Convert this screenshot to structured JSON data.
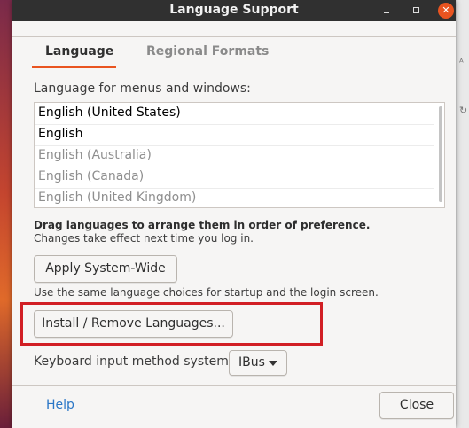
{
  "window": {
    "title": "Language Support"
  },
  "tabs": [
    {
      "label": "Language",
      "active": true
    },
    {
      "label": "Regional Formats",
      "active": false
    }
  ],
  "language_section": {
    "label": "Language for menus and windows:",
    "languages": [
      {
        "name": "English (United States)",
        "enabled": true
      },
      {
        "name": "English",
        "enabled": true
      },
      {
        "name": "English (Australia)",
        "enabled": false
      },
      {
        "name": "English (Canada)",
        "enabled": false
      },
      {
        "name": "English (United Kingdom)",
        "enabled": false
      }
    ],
    "drag_hint": "Drag languages to arrange them in order of preference.",
    "drag_note": "Changes take effect next time you log in."
  },
  "buttons": {
    "apply_system_wide": "Apply System-Wide",
    "apply_note": "Use the same language choices for startup and the login screen.",
    "install_remove": "Install / Remove Languages...",
    "close": "Close",
    "help": "Help"
  },
  "keyboard": {
    "label": "Keyboard input method system:",
    "selected": "IBus"
  },
  "colors": {
    "accent": "#e95420",
    "highlight_box": "#d11f24",
    "link": "#2a76c6"
  }
}
